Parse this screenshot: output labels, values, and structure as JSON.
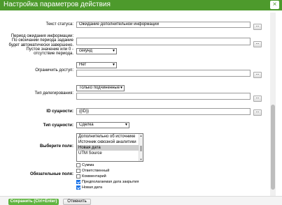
{
  "window": {
    "title": "Настройка параметров действия",
    "close_glyph": "×"
  },
  "fields": {
    "status_text": {
      "label": "Текст статуса:",
      "value": "Ожидание дополнительной информации"
    },
    "wait_period": {
      "label_lines": [
        "Период ожидания информации:",
        "По окончании периода задание",
        "будет автоматически завершено.",
        "Пустое значение или 0 -",
        "отсутствие периода."
      ],
      "unit": "секунд"
    },
    "restrict_access": {
      "label": "Ограничить доступ:",
      "value": "Нет"
    },
    "delegation_type": {
      "label": "Тип делегирования:",
      "value": "Только подчиненные"
    },
    "entity_id": {
      "label": "ID сущности:",
      "value": "{{ID}}"
    },
    "entity_type": {
      "label": "Тип сущности:",
      "value": "Сделка"
    },
    "select_field": {
      "label": "Выберите поле:",
      "options": [
        "Дополнительно об источнике",
        "Источник сквозной аналитики",
        "Новая дата",
        "UTM Source"
      ],
      "selected": "Новая дата"
    },
    "required_fields": {
      "label": "Обязательные поля:",
      "items": [
        {
          "label": "Сумма",
          "checked": false
        },
        {
          "label": "Ответственный",
          "checked": false
        },
        {
          "label": "Комментарий",
          "checked": false
        },
        {
          "label": "Предполагаемая дата закрытия",
          "checked": true
        },
        {
          "label": "Новая дата",
          "checked": true
        }
      ]
    }
  },
  "dots_label": "...",
  "buttons": {
    "save": "Сохранить (Ctrl+Enter)",
    "cancel": "Отменить"
  },
  "colors": {
    "titlebar": "#4d9a2c",
    "save_button": "#5fb43f",
    "checkbox_on": "#1a73e8"
  }
}
